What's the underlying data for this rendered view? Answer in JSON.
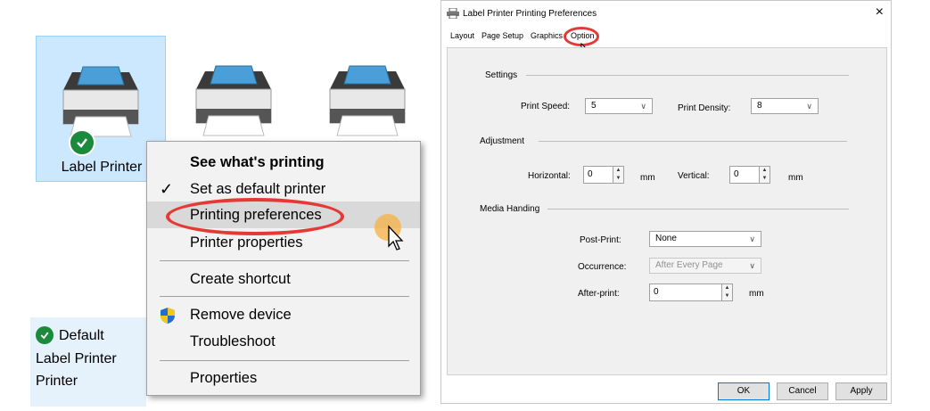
{
  "left": {
    "printers": [
      {
        "label": "Label Printer",
        "selected": true
      },
      {
        "label": "",
        "selected": false
      },
      {
        "label": "",
        "selected": false
      }
    ],
    "context_menu": {
      "items": [
        {
          "label": "See what's printing",
          "bold": true
        },
        {
          "label": "Set as default printer",
          "checked": true
        },
        {
          "label": "Printing preferences",
          "highlighted": true
        },
        {
          "label": "Printer properties"
        },
        {
          "label": "Create shortcut"
        },
        {
          "label": "Remove device",
          "icon": "shield-icon"
        },
        {
          "label": "Troubleshoot"
        },
        {
          "label": "Properties"
        }
      ]
    },
    "bottom_info": {
      "line1": "Default",
      "line2": "Label Printer",
      "line3": "Printer"
    }
  },
  "dialog": {
    "title": "Label Printer Printing Preferences",
    "close_label": "×",
    "tabs": [
      "Layout",
      "Page Setup",
      "Graphics",
      "Option"
    ],
    "active_tab": "Option",
    "settings": {
      "section": "Settings",
      "print_speed_label": "Print Speed:",
      "print_speed_value": "5",
      "print_density_label": "Print Density:",
      "print_density_value": "8"
    },
    "adjustment": {
      "section": "Adjustment",
      "horizontal_label": "Horizontal:",
      "horizontal_value": "0",
      "horizontal_unit": "mm",
      "vertical_label": "Vertical:",
      "vertical_value": "0",
      "vertical_unit": "mm"
    },
    "media": {
      "section": "Media Handing",
      "post_print_label": "Post-Print:",
      "post_print_value": "None",
      "occurrence_label": "Occurrence:",
      "occurrence_value": "After Every Page",
      "after_print_label": "After-print:",
      "after_print_value": "0",
      "after_print_unit": "mm"
    },
    "buttons": {
      "ok": "OK",
      "cancel": "Cancel",
      "apply": "Apply"
    }
  },
  "colors": {
    "selection": "#cce8ff",
    "highlight": "#e53935",
    "check": "#1c8a3c"
  }
}
